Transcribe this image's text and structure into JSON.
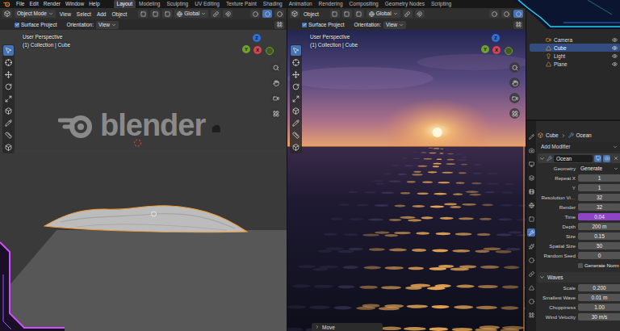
{
  "menu": {
    "items": [
      "File",
      "Edit",
      "Render",
      "Window",
      "Help"
    ]
  },
  "workspaces": [
    {
      "label": "Layout",
      "selected": true
    },
    {
      "label": "Modeling",
      "selected": false
    },
    {
      "label": "Sculpting",
      "selected": false
    },
    {
      "label": "UV Editing",
      "selected": false
    },
    {
      "label": "Texture Paint",
      "selected": false
    },
    {
      "label": "Shading",
      "selected": false
    },
    {
      "label": "Animation",
      "selected": false
    },
    {
      "label": "Rendering",
      "selected": false
    },
    {
      "label": "Compositing",
      "selected": false
    },
    {
      "label": "Geometry Nodes",
      "selected": false
    },
    {
      "label": "Scripting",
      "selected": false
    }
  ],
  "viewports": [
    {
      "shading": "solid",
      "mode": "Object Mode",
      "menus": [
        "View",
        "Select",
        "Add",
        "Object"
      ],
      "transform": "Global",
      "surface_project": {
        "label": "Surface Project",
        "checked": true
      },
      "orientation": {
        "label": "Orientation:",
        "value": "View"
      },
      "perspective": "User Perspective",
      "collection": "(1) Collection | Cube",
      "watermark": "blender",
      "operator_panel": null,
      "gizmo": [
        {
          "label": "Z",
          "color": "#2e6fd9"
        },
        {
          "label": "Y",
          "color": "#6ea12f"
        },
        {
          "label": "X",
          "color": "#d8434e"
        }
      ],
      "tools": [
        {
          "kind": "select",
          "selected": true
        },
        {
          "kind": "cursor",
          "selected": false
        },
        {
          "kind": "move",
          "selected": false
        },
        {
          "kind": "rotate",
          "selected": false
        },
        {
          "kind": "scale",
          "selected": false
        },
        {
          "kind": "transform",
          "selected": false
        },
        {
          "kind": "annotate",
          "selected": false
        },
        {
          "kind": "measure",
          "selected": false
        },
        {
          "kind": "add_cube",
          "selected": false
        }
      ]
    },
    {
      "shading": "rendered",
      "mode": null,
      "menus": [
        "Object"
      ],
      "transform": "Global",
      "surface_project": {
        "label": "Surface Project",
        "checked": true
      },
      "orientation": {
        "label": "Orientation:",
        "value": "View"
      },
      "perspective": "User Perspective",
      "collection": "(1) Collection | Cube",
      "watermark": null,
      "operator_panel": "Move",
      "gizmo": [
        {
          "label": "Z",
          "color": "#2e6fd9"
        },
        {
          "label": "Y",
          "color": "#6ea12f"
        },
        {
          "label": "X",
          "color": "#d8434e"
        }
      ],
      "tools": [
        {
          "kind": "select",
          "selected": true
        },
        {
          "kind": "cursor",
          "selected": false
        },
        {
          "kind": "move",
          "selected": false
        },
        {
          "kind": "rotate",
          "selected": false
        },
        {
          "kind": "scale",
          "selected": false
        },
        {
          "kind": "transform",
          "selected": false
        },
        {
          "kind": "annotate",
          "selected": false
        },
        {
          "kind": "measure",
          "selected": false
        },
        {
          "kind": "add_cube",
          "selected": false
        }
      ]
    }
  ],
  "outliner": {
    "items": [
      {
        "name": "Camera",
        "kind": "camera",
        "selected": false
      },
      {
        "name": "Cube",
        "kind": "mesh",
        "selected": true
      },
      {
        "name": "Light",
        "kind": "light",
        "selected": false
      },
      {
        "name": "Plane",
        "kind": "mesh",
        "selected": false
      }
    ]
  },
  "properties": {
    "tabs": [
      {
        "kind": "tool",
        "selected": false
      },
      {
        "kind": "render",
        "selected": false
      },
      {
        "kind": "output",
        "selected": false
      },
      {
        "kind": "view_layer",
        "selected": false
      },
      {
        "kind": "scene",
        "selected": false
      },
      {
        "kind": "world",
        "selected": false
      },
      {
        "kind": "object",
        "selected": false
      },
      {
        "kind": "modifier",
        "selected": true
      },
      {
        "kind": "particles",
        "selected": false
      },
      {
        "kind": "physics",
        "selected": false
      },
      {
        "kind": "constraints",
        "selected": false
      },
      {
        "kind": "data",
        "selected": false
      },
      {
        "kind": "material",
        "selected": false
      },
      {
        "kind": "texture",
        "selected": false
      }
    ],
    "breadcrumb": [
      "Cube",
      "Ocean"
    ],
    "add_modifier": "Add Modifier",
    "modifier": {
      "name": "Ocean",
      "expanded": true
    },
    "fields": [
      {
        "label": "Geometry",
        "value": "Generate",
        "kind": "dropdown",
        "animated": false
      },
      {
        "label": "Repeat X",
        "value": "1",
        "kind": "number",
        "animated": false
      },
      {
        "label": "Y",
        "value": "1",
        "kind": "number",
        "animated": false
      },
      {
        "label": "Resolution Vi…",
        "value": "32",
        "kind": "number",
        "animated": false
      },
      {
        "label": "Render",
        "value": "32",
        "kind": "number",
        "animated": false
      },
      {
        "label": "Time",
        "value": "0.04",
        "kind": "number",
        "animated": true
      },
      {
        "label": "Depth",
        "value": "200 m",
        "kind": "number",
        "animated": false
      },
      {
        "label": "Size",
        "value": "0.15",
        "kind": "number",
        "animated": false
      },
      {
        "label": "Spatial Size",
        "value": "50",
        "kind": "number",
        "animated": false
      },
      {
        "label": "Random Seed",
        "value": "0",
        "kind": "number",
        "animated": false
      },
      {
        "label": "Generate Norm",
        "kind": "checkbox",
        "checked": false
      }
    ],
    "sections": [
      {
        "title": "Waves",
        "expanded": true,
        "fields": [
          {
            "label": "Scale",
            "value": "0.200",
            "kind": "number",
            "animated": false
          },
          {
            "label": "Smallest Wave",
            "value": "0.01 m",
            "kind": "number",
            "animated": false
          },
          {
            "label": "Choppiness",
            "value": "1.00",
            "kind": "number",
            "animated": false
          },
          {
            "label": "Wind Velocity",
            "value": "30 m/s",
            "kind": "number",
            "animated": false
          }
        ]
      }
    ]
  }
}
